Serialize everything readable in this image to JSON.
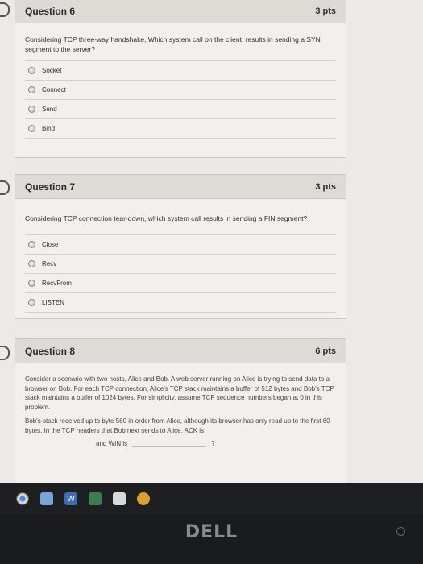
{
  "questions": [
    {
      "title": "Question 6",
      "points": "3 pts",
      "prompt": "Considering TCP three-way handshake, Which system call on the client, results in sending a SYN segment to the server?",
      "options": [
        "Socket",
        "Connect",
        "Send",
        "Bind"
      ]
    },
    {
      "title": "Question 7",
      "points": "3 pts",
      "prompt": "Considering TCP connection tear-down, which system call results in sending a FIN segment?",
      "options": [
        "Close",
        "Recv",
        "RecvFrom",
        "LISTEN"
      ]
    },
    {
      "title": "Question 8",
      "points": "6 pts",
      "paragraph1": "Consider a scenario with two hosts, Alice and Bob. A web server running on Alice is trying to send data to a browser on Bob. For each TCP connection, Alice's TCP stack maintains a buffer of 512 bytes and Bob's TCP stack maintains a buffer of 1024 bytes. For simplicity, assume TCP sequence numbers began at 0 in this problem.",
      "paragraph2": "Bob's stack received up to byte 560 in order from Alice, although its browser has only read up to the first 60 bytes. In the TCP headers that Bob next sends to Alice, ACK is",
      "blank_prefix": "and WIN is",
      "blank_suffix": "?"
    }
  ],
  "taskbar": {
    "icons": [
      "chrome-icon",
      "file-explorer-icon",
      "word-icon",
      "photos-icon",
      "store-icon",
      "media-icon"
    ]
  },
  "monitor": {
    "brand": "DELL"
  },
  "colors": {
    "card_header": "#dcdbd6",
    "taskbar": "#1d1f22",
    "page_bg": "#eceae6"
  }
}
